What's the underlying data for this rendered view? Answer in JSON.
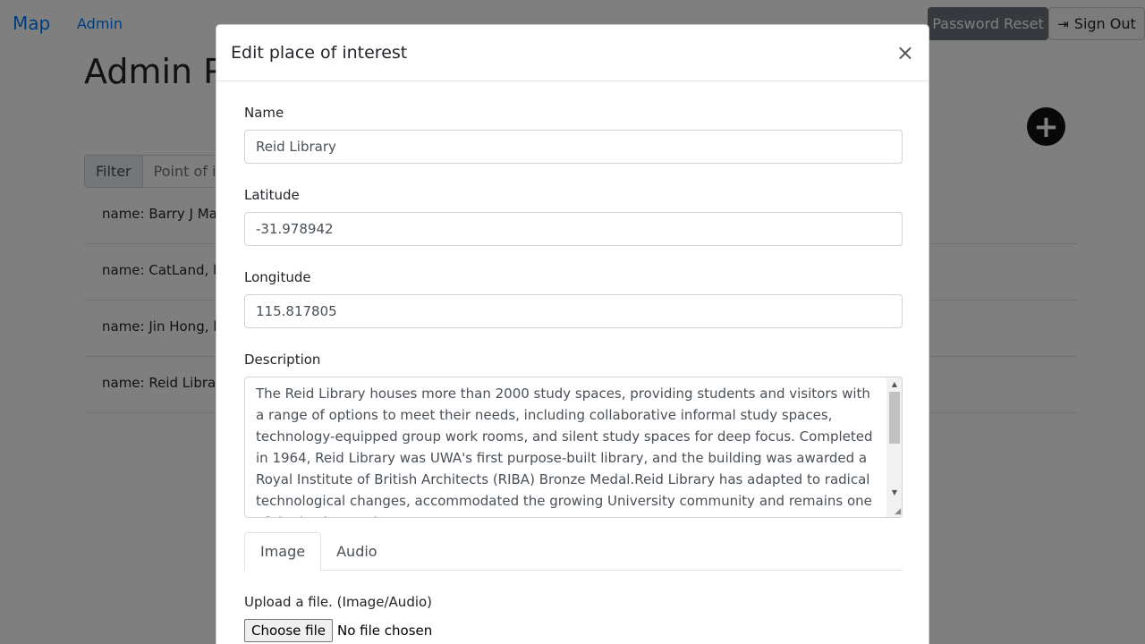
{
  "nav": {
    "brand": "Map",
    "admin": "Admin",
    "password_reset": "Password Reset",
    "sign_out": "Sign Out"
  },
  "page": {
    "title": "Admin P",
    "filter_label": "Filter",
    "filter_placeholder": "Point of int",
    "items": [
      "name: Barry J Mars",
      "name: CatLand, lat",
      "name: Jin Hong, la",
      "name: Reid Library"
    ]
  },
  "modal": {
    "title": "Edit place of interest",
    "close": "×",
    "name_label": "Name",
    "name_value": "Reid Library",
    "latitude_label": "Latitude",
    "latitude_value": "-31.978942",
    "longitude_label": "Longitude",
    "longitude_value": "115.817805",
    "description_label": "Description",
    "description_value": "The Reid Library houses more than 2000 study spaces, providing students and visitors with a range of options to meet their needs, including collaborative informal study spaces, technology-equipped group work rooms, and silent study spaces for deep focus. Completed in 1964, Reid Library was UWA's first purpose-built library, and the building was awarded a Royal Institute of British Architects (RIBA) Bronze Medal.Reid Library has adapted to radical technological changes, accommodated the growing University community and remains one of the busiest and most",
    "tabs": [
      "Image",
      "Audio"
    ],
    "upload_label": "Upload a file. (Image/Audio)",
    "choose_file": "Choose file",
    "file_status": "No file chosen"
  }
}
